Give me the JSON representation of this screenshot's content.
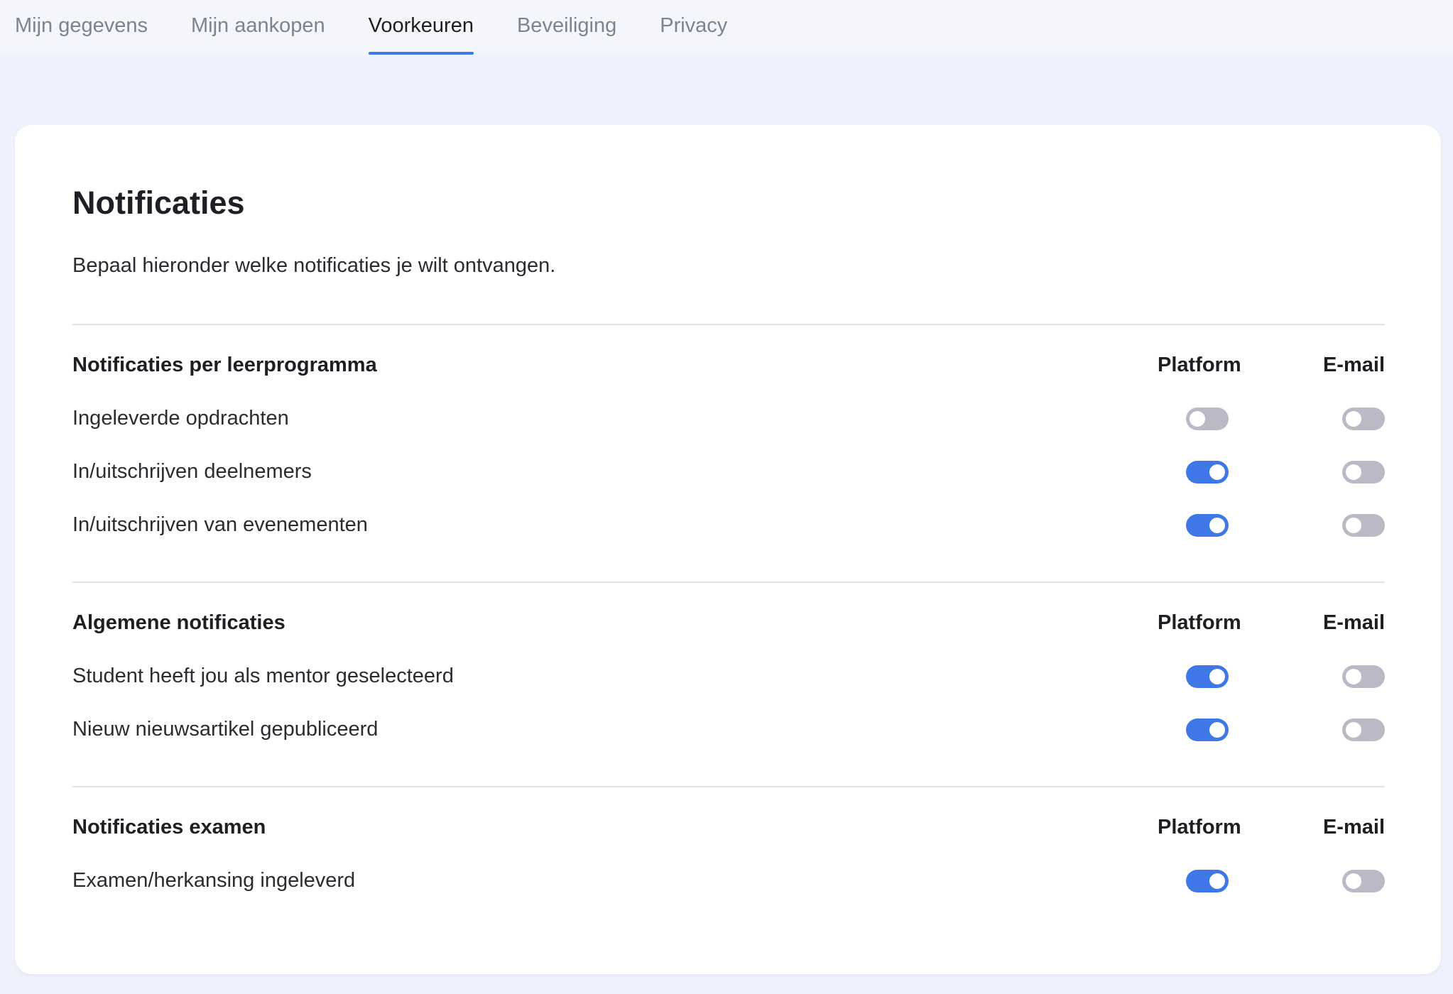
{
  "tabs": [
    {
      "label": "Mijn gegevens",
      "active": false
    },
    {
      "label": "Mijn aankopen",
      "active": false
    },
    {
      "label": "Voorkeuren",
      "active": true
    },
    {
      "label": "Beveiliging",
      "active": false
    },
    {
      "label": "Privacy",
      "active": false
    }
  ],
  "card": {
    "title": "Notificaties",
    "description": "Bepaal hieronder welke notificaties je wilt ontvangen."
  },
  "colors": {
    "accent": "#3f78e6",
    "toggle_off": "#b9bac5"
  },
  "sections": [
    {
      "title": "Notificaties per leerprogramma",
      "col_platform": "Platform",
      "col_email": "E-mail",
      "rows": [
        {
          "label": "Ingeleverde opdrachten",
          "platform": false,
          "email": false
        },
        {
          "label": "In/uitschrijven deelnemers",
          "platform": true,
          "email": false
        },
        {
          "label": "In/uitschrijven van evenementen",
          "platform": true,
          "email": false
        }
      ]
    },
    {
      "title": "Algemene notificaties",
      "col_platform": "Platform",
      "col_email": "E-mail",
      "rows": [
        {
          "label": "Student heeft jou als mentor geselecteerd",
          "platform": true,
          "email": false
        },
        {
          "label": "Nieuw nieuwsartikel gepubliceerd",
          "platform": true,
          "email": false
        }
      ]
    },
    {
      "title": "Notificaties examen",
      "col_platform": "Platform",
      "col_email": "E-mail",
      "rows": [
        {
          "label": "Examen/herkansing ingeleverd",
          "platform": true,
          "email": false
        }
      ]
    }
  ]
}
